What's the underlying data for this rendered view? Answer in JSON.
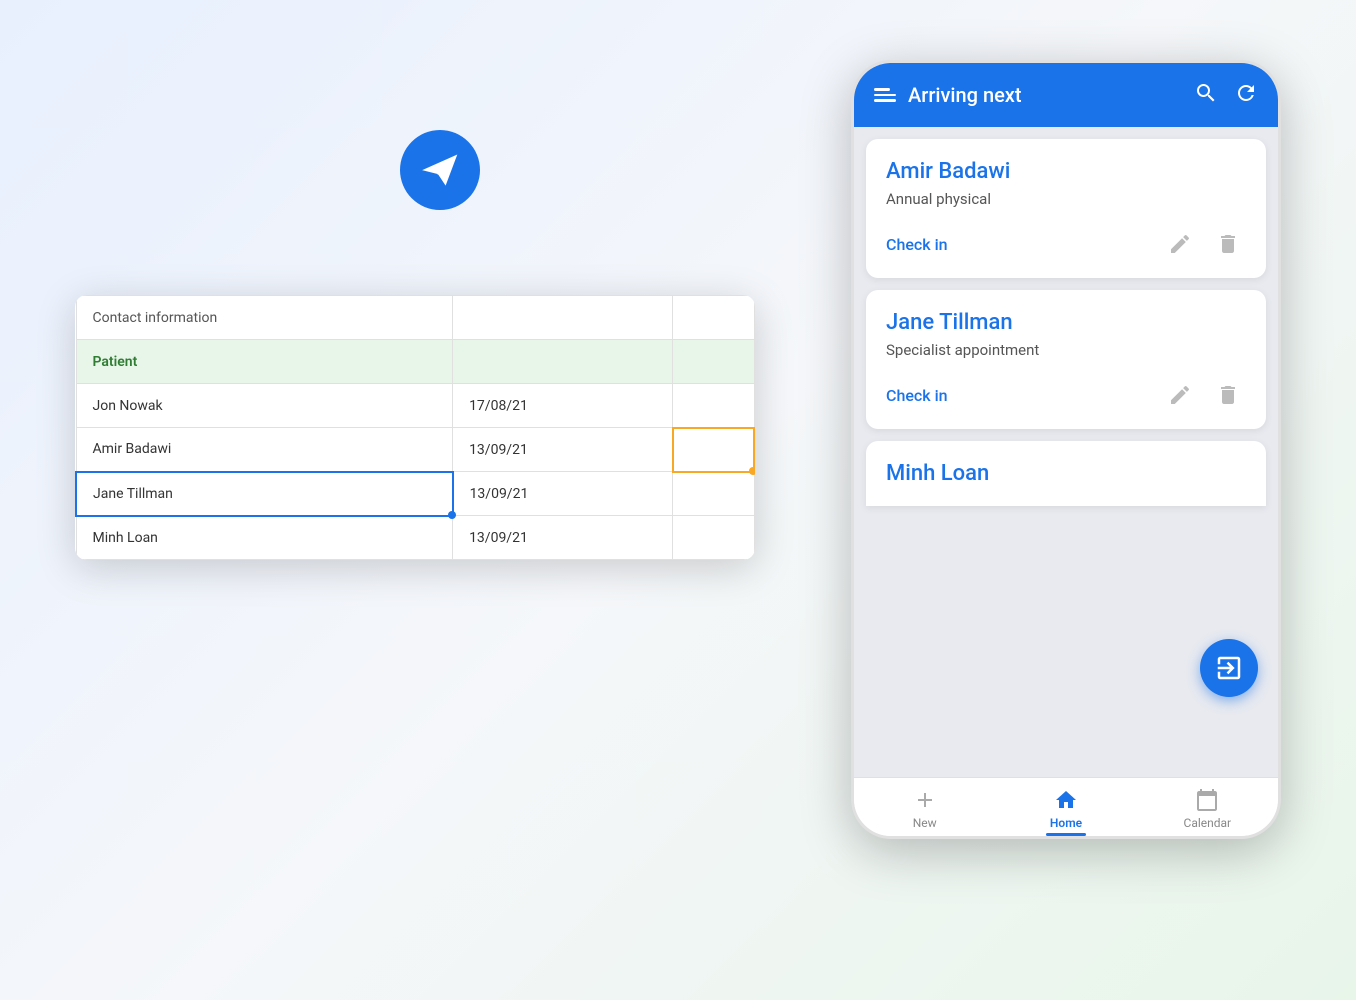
{
  "app": {
    "phone_header": {
      "title": "Arriving next",
      "menu_icon": "menu-icon",
      "search_icon": "search-icon",
      "refresh_icon": "refresh-icon"
    },
    "patients": [
      {
        "name": "Amir Badawi",
        "appointment": "Annual physical",
        "check_in_label": "Check in"
      },
      {
        "name": "Jane Tillman",
        "appointment": "Specialist appointment",
        "check_in_label": "Check in"
      },
      {
        "name": "Minh Loan",
        "appointment": "",
        "check_in_label": ""
      }
    ],
    "bottom_nav": [
      {
        "label": "New",
        "icon": "plus-icon",
        "active": false
      },
      {
        "label": "Home",
        "icon": "home-icon",
        "active": true
      },
      {
        "label": "Calendar",
        "icon": "calendar-icon",
        "active": false
      }
    ],
    "fab": {
      "icon": "login-icon"
    }
  },
  "spreadsheet": {
    "header_row": {
      "col1": "Contact information",
      "col2": "",
      "col3": ""
    },
    "section_label": "Patient",
    "rows": [
      {
        "name": "Jon Nowak",
        "date": "17/08/21",
        "col3": ""
      },
      {
        "name": "Amir Badawi",
        "date": "13/09/21",
        "col3": ""
      },
      {
        "name": "Jane Tillman",
        "date": "13/09/21",
        "col3": ""
      },
      {
        "name": "Minh Loan",
        "date": "13/09/21",
        "col3": ""
      }
    ]
  }
}
